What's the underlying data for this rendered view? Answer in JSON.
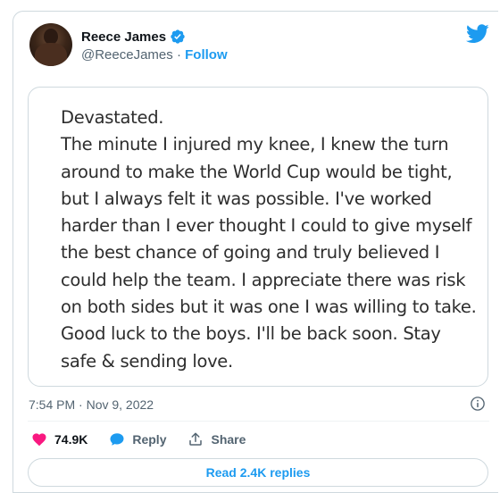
{
  "author": {
    "display_name": "Reece James",
    "handle": "@ReeceJames",
    "separator": " · ",
    "follow_label": "Follow"
  },
  "note": {
    "text": "Devastated.\nThe minute I injured my knee, I knew the turn around to make the World Cup would be tight, but I always felt it was possible. I've worked harder than I ever thought I could to give myself the best chance of going and truly believed I could help the team.  I appreciate there was risk on both sides but it was one I was willing to take. Good luck to the boys. I'll be back soon. Stay safe & sending love."
  },
  "meta": {
    "timestamp": "7:54 PM · Nov 9, 2022"
  },
  "actions": {
    "likes": "74.9K",
    "reply_label": "Reply",
    "share_label": "Share"
  },
  "replies_button": {
    "label": "Read 2.4K replies"
  },
  "colors": {
    "accent": "#1d9bf0",
    "like": "#f91880",
    "muted": "#536471",
    "border": "#cfd9de"
  },
  "icons": {
    "brand": "twitter-bird-icon",
    "verified": "verified-badge-icon",
    "info": "info-icon",
    "like": "heart-icon",
    "reply": "speech-bubble-icon",
    "share": "share-icon"
  }
}
